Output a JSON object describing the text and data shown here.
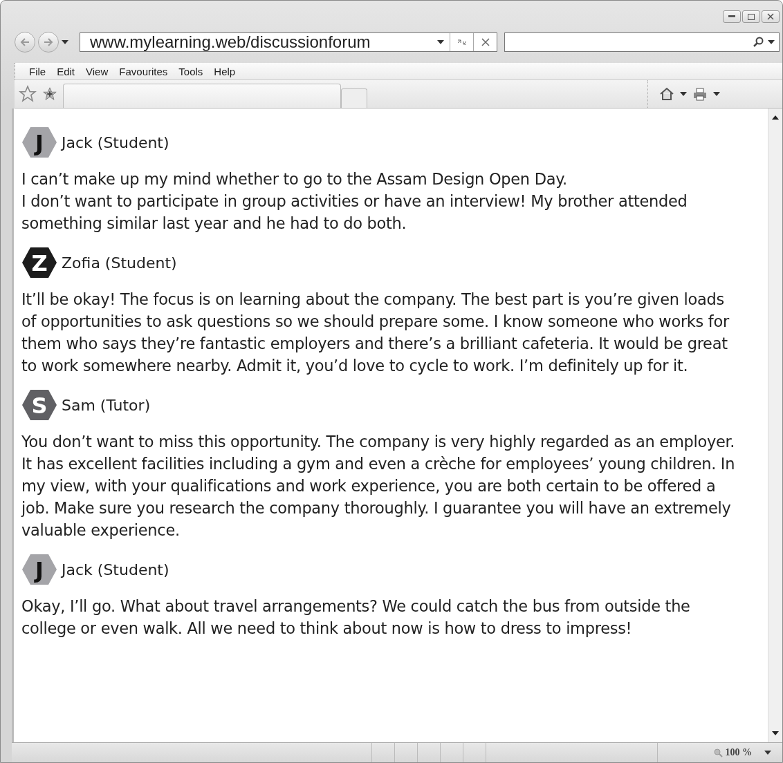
{
  "address_bar": {
    "url": "www.mylearning.web/discussionforum"
  },
  "menu": [
    "File",
    "Edit",
    "View",
    "Favourites",
    "Tools",
    "Help"
  ],
  "posts": [
    {
      "avatar_letter": "J",
      "color": "#a4a4a8",
      "author": "Jack (Student)",
      "text": "I can’t make up my mind whether to go to the Assam Design Open Day.\nI don’t want to participate in group activities or have an interview! My brother attended something similar last year and he had to do both."
    },
    {
      "avatar_letter": "Z",
      "color": "#1c1c1c",
      "author": "Zofia (Student)",
      "text": "It’ll be okay! The focus is on learning about the company. The best part is you’re given loads of opportunities to ask questions so we should prepare some. I know someone who works for them who says they’re fantastic employers and there’s a brilliant cafeteria. It would be great to work somewhere nearby. Admit it, you’d love to cycle to work. I’m definitely up for it."
    },
    {
      "avatar_letter": "S",
      "color": "#606064",
      "author": "Sam (Tutor)",
      "text": "You don’t want to miss this opportunity. The company is very highly regarded as an employer. It has excellent facilities including a gym and even a crèche for employees’ young children. In my view, with your qualifications and work experience, you are both certain to be offered a job. Make sure you research the company thoroughly. I guarantee you will have an extremely valuable experience."
    },
    {
      "avatar_letter": "J",
      "color": "#a4a4a8",
      "author": "Jack (Student)",
      "text": "Okay, I’ll go. What about travel arrangements? We could catch the bus from outside the college or even walk. All we need to think about now is how to dress to impress!"
    }
  ],
  "status_bar": {
    "zoom": "100 %"
  }
}
